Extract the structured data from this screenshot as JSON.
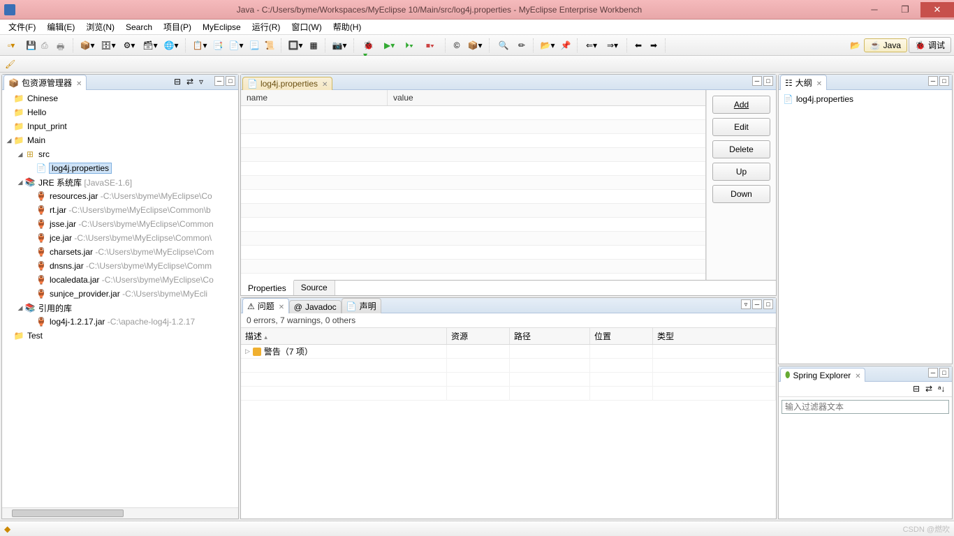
{
  "title": "Java  -  C:/Users/byme/Workspaces/MyEclipse 10/Main/src/log4j.properties  -  MyEclipse Enterprise Workbench",
  "menu": [
    "文件(F)",
    "编辑(E)",
    "浏览(N)",
    "Search",
    "项目(P)",
    "MyEclipse",
    "运行(R)",
    "窗口(W)",
    "帮助(H)"
  ],
  "perspectives": {
    "java": "Java",
    "debug": "调试"
  },
  "views": {
    "package_explorer": {
      "title": "包资源管理器"
    },
    "outline": {
      "title": "大纲",
      "item": "log4j.properties"
    },
    "spring": {
      "title": "Spring Explorer",
      "placeholder": "输入过滤器文本"
    },
    "problems": {
      "title": "问题",
      "javadoc": "Javadoc",
      "decl": "声明",
      "summary": "0 errors, 7 warnings, 0 others",
      "cols": {
        "desc": "描述",
        "res": "资源",
        "path": "路径",
        "loc": "位置",
        "type": "类型"
      },
      "warn_row": "警告（7 项）"
    }
  },
  "editor": {
    "tab": "log4j.properties",
    "columns": {
      "name": "name",
      "value": "value"
    },
    "buttons": {
      "add": "Add",
      "edit": "Edit",
      "delete": "Delete",
      "up": "Up",
      "down": "Down"
    },
    "bottom_tabs": {
      "props": "Properties",
      "source": "Source"
    }
  },
  "tree": {
    "projects": [
      {
        "name": "Chinese"
      },
      {
        "name": "Hello"
      },
      {
        "name": "Input_print"
      },
      {
        "name": "Main",
        "expanded": true,
        "children": [
          {
            "name": "src",
            "kind": "pkg",
            "expanded": true,
            "children": [
              {
                "name": "log4j.properties",
                "kind": "file",
                "selected": true
              }
            ]
          },
          {
            "name": "JRE 系统库",
            "kind": "lib",
            "hint": "[JavaSE-1.6]",
            "expanded": true,
            "children": [
              {
                "name": "resources.jar",
                "kind": "jar",
                "hint": "-C:\\Users\\byme\\MyEclipse\\Co"
              },
              {
                "name": "rt.jar",
                "kind": "jar",
                "hint": "-C:\\Users\\byme\\MyEclipse\\Common\\b"
              },
              {
                "name": "jsse.jar",
                "kind": "jar",
                "hint": "-C:\\Users\\byme\\MyEclipse\\Common"
              },
              {
                "name": "jce.jar",
                "kind": "jar",
                "hint": "-C:\\Users\\byme\\MyEclipse\\Common\\"
              },
              {
                "name": "charsets.jar",
                "kind": "jar",
                "hint": "-C:\\Users\\byme\\MyEclipse\\Com"
              },
              {
                "name": "dnsns.jar",
                "kind": "jar",
                "hint": "-C:\\Users\\byme\\MyEclipse\\Comm"
              },
              {
                "name": "localedata.jar",
                "kind": "jar",
                "hint": "-C:\\Users\\byme\\MyEclipse\\Co"
              },
              {
                "name": "sunjce_provider.jar",
                "kind": "jar",
                "hint": "-C:\\Users\\byme\\MyEcli"
              }
            ]
          },
          {
            "name": "引用的库",
            "kind": "lib",
            "expanded": true,
            "children": [
              {
                "name": "log4j-1.2.17.jar",
                "kind": "jar",
                "hint": "-C:\\apache-log4j-1.2.17"
              }
            ]
          }
        ]
      },
      {
        "name": "Test"
      }
    ]
  },
  "watermark": "CSDN @燃吹"
}
